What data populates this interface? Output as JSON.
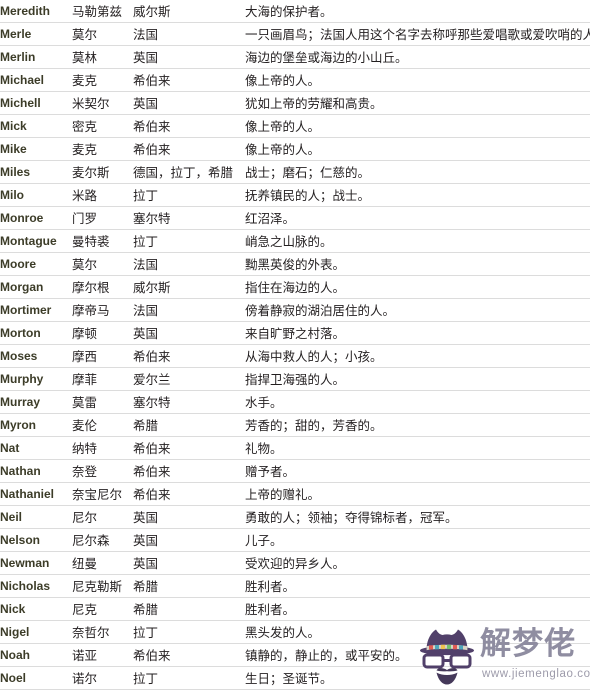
{
  "table": {
    "columns": [
      "english_name",
      "chinese_transliteration",
      "origin",
      "meaning"
    ],
    "rows": [
      {
        "en": "Meredith",
        "cn": "马勒第兹",
        "origin": "威尔斯",
        "meaning": "大海的保护者。"
      },
      {
        "en": "Merle",
        "cn": "莫尔",
        "origin": "法国",
        "meaning": "一只画眉鸟；法国人用这个名字去称呼那些爱唱歌或爱吹哨的人"
      },
      {
        "en": "Merlin",
        "cn": "莫林",
        "origin": "英国",
        "meaning": "海边的堡垒或海边的小山丘。"
      },
      {
        "en": "Michael",
        "cn": "麦克",
        "origin": "希伯来",
        "meaning": "像上帝的人。"
      },
      {
        "en": "Michell",
        "cn": "米契尔",
        "origin": "英国",
        "meaning": "犹如上帝的劳耀和高贵。"
      },
      {
        "en": "Mick",
        "cn": "密克",
        "origin": "希伯来",
        "meaning": "像上帝的人。"
      },
      {
        "en": "Mike",
        "cn": "麦克",
        "origin": "希伯来",
        "meaning": "像上帝的人。"
      },
      {
        "en": "Miles",
        "cn": "麦尔斯",
        "origin": "德国，拉丁，希腊",
        "meaning": "战士；磨石；仁慈的。"
      },
      {
        "en": "Milo",
        "cn": "米路",
        "origin": "拉丁",
        "meaning": "抚养镇民的人；战士。"
      },
      {
        "en": "Monroe",
        "cn": "门罗",
        "origin": "塞尔特",
        "meaning": "红沼泽。"
      },
      {
        "en": "Montague",
        "cn": "曼特裘",
        "origin": "拉丁",
        "meaning": "峭急之山脉的。"
      },
      {
        "en": "Moore",
        "cn": "莫尔",
        "origin": "法国",
        "meaning": "黝黑英俊的外表。"
      },
      {
        "en": "Morgan",
        "cn": "摩尔根",
        "origin": "威尔斯",
        "meaning": "指住在海边的人。"
      },
      {
        "en": "Mortimer",
        "cn": "摩帝马",
        "origin": "法国",
        "meaning": "傍着静寂的湖泊居住的人。"
      },
      {
        "en": "Morton",
        "cn": "摩顿",
        "origin": "英国",
        "meaning": "来自旷野之村落。"
      },
      {
        "en": "Moses",
        "cn": "摩西",
        "origin": "希伯来",
        "meaning": "从海中救人的人；小孩。"
      },
      {
        "en": "Murphy",
        "cn": "摩菲",
        "origin": "爱尔兰",
        "meaning": "指捍卫海强的人。"
      },
      {
        "en": "Murray",
        "cn": "莫雷",
        "origin": "塞尔特",
        "meaning": "水手。"
      },
      {
        "en": "Myron",
        "cn": "麦伦",
        "origin": "希腊",
        "meaning": "芳香的；甜的，芳香的。"
      },
      {
        "en": "Nat",
        "cn": "纳特",
        "origin": "希伯来",
        "meaning": "礼物。"
      },
      {
        "en": "Nathan",
        "cn": "奈登",
        "origin": "希伯来",
        "meaning": "赠予者。"
      },
      {
        "en": "Nathaniel",
        "cn": "奈宝尼尔",
        "origin": "希伯来",
        "meaning": "上帝的赠礼。"
      },
      {
        "en": "Neil",
        "cn": "尼尔",
        "origin": "英国",
        "meaning": "勇敢的人；领袖；夺得锦标者，冠军。"
      },
      {
        "en": "Nelson",
        "cn": "尼尔森",
        "origin": "英国",
        "meaning": "儿子。"
      },
      {
        "en": "Newman",
        "cn": "纽曼",
        "origin": "英国",
        "meaning": "受欢迎的异乡人。"
      },
      {
        "en": "Nicholas",
        "cn": "尼克勒斯",
        "origin": "希腊",
        "meaning": "胜利者。"
      },
      {
        "en": "Nick",
        "cn": "尼克",
        "origin": "希腊",
        "meaning": "胜利者。"
      },
      {
        "en": "Nigel",
        "cn": "奈哲尔",
        "origin": "拉丁",
        "meaning": "黑头发的人。"
      },
      {
        "en": "Noah",
        "cn": "诺亚",
        "origin": "希伯来",
        "meaning": "镇静的，静止的，或平安的。"
      },
      {
        "en": "Noel",
        "cn": "诺尔",
        "origin": "拉丁",
        "meaning": "生日；圣诞节。"
      }
    ]
  },
  "watermark": {
    "brand_cn": "解梦佬",
    "url": "www.jiemenglao.com",
    "logo_icon": "hipster-face-icon",
    "brand_color": "#8c8a9e",
    "hat_color": "#4c3a66",
    "beard_color": "#3f3355"
  }
}
